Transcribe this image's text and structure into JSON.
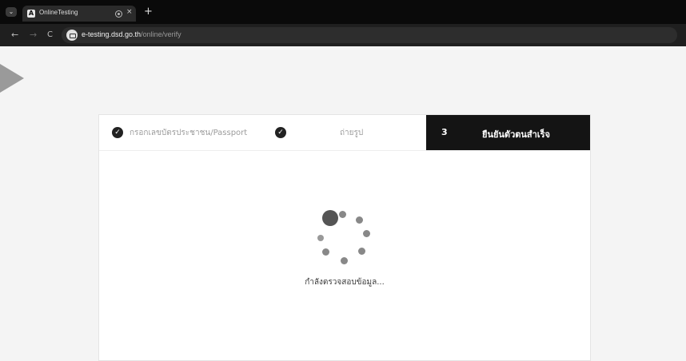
{
  "browser": {
    "menu_icon": "chevron-down-icon",
    "tab": {
      "favicon": "A",
      "title": "OnlineTesting",
      "close": "×"
    },
    "new_tab": "+",
    "nav": {
      "back": "←",
      "forward": "→",
      "reload": "C"
    },
    "url": {
      "domain": "e-testing.dsd.go.th",
      "path": "/online/verify"
    }
  },
  "steps": [
    {
      "label": "กรอกเลขบัตรประชาชน/Passport",
      "status": "done"
    },
    {
      "label": "ถ่ายรูป",
      "status": "done"
    },
    {
      "number": "3",
      "label": "ยืนยันตัวตนสำเร็จ",
      "status": "active"
    }
  ],
  "check_glyph": "✓",
  "loading": {
    "message": "กำลังตรวจสอบข้อมูล..."
  }
}
